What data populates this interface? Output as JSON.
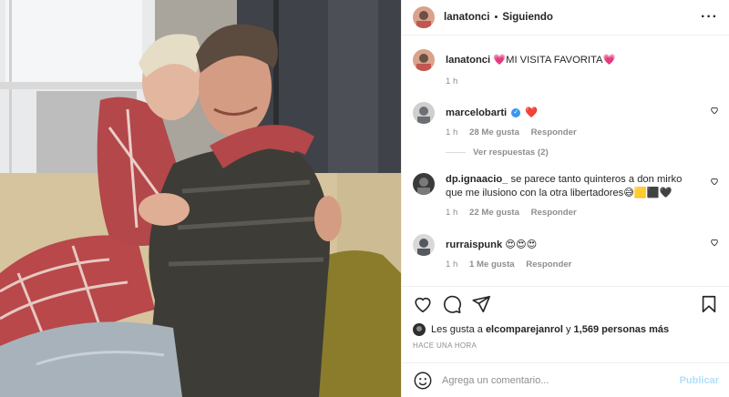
{
  "post": {
    "username": "lanatonci",
    "follow_status": "Siguiendo",
    "separator": "•",
    "caption": "💗MI VISITA FAVORITA💗",
    "caption_time": "1 h"
  },
  "comments": [
    {
      "username": "marcelobarti",
      "text": "❤️",
      "verified": true,
      "time": "1 h",
      "likes": "28 Me gusta",
      "reply": "Responder",
      "avatar_color": "#6b6f74"
    },
    {
      "username": "dp.ignaacio_",
      "text": "se parece tanto quinteros a don mirko que me ilusiono con la otra libertadores😅🟨⬛🖤",
      "verified": false,
      "time": "1 h",
      "likes": "22 Me gusta",
      "reply": "Responder",
      "avatar_color": "#4a4a4a"
    },
    {
      "username": "rurraispunk",
      "text": "😍😍😍",
      "verified": false,
      "time": "1 h",
      "likes": "1 Me gusta",
      "reply": "Responder",
      "avatar_color": "#55585c"
    }
  ],
  "view_replies": "Ver respuestas (2)",
  "likes_line": {
    "prefix": "Les gusta a",
    "user": "elcomparejanrol",
    "middle": "y",
    "count": "1,569 personas más"
  },
  "timestamp": "HACE UNA HORA",
  "comment_box": {
    "placeholder": "Agrega un comentario...",
    "publish": "Publicar"
  },
  "icons": {
    "more": "more-options-icon",
    "like": "heart-icon",
    "comment": "comment-icon",
    "share": "paper-plane-icon",
    "save": "bookmark-icon",
    "emoji": "emoji-icon",
    "comment_like": "small-heart-icon"
  },
  "colors": {
    "text": "#262626",
    "muted": "#8e8e8e",
    "verified": "#3897f0",
    "publish_disabled": "#b2dffc",
    "heart": "#ed4956"
  }
}
